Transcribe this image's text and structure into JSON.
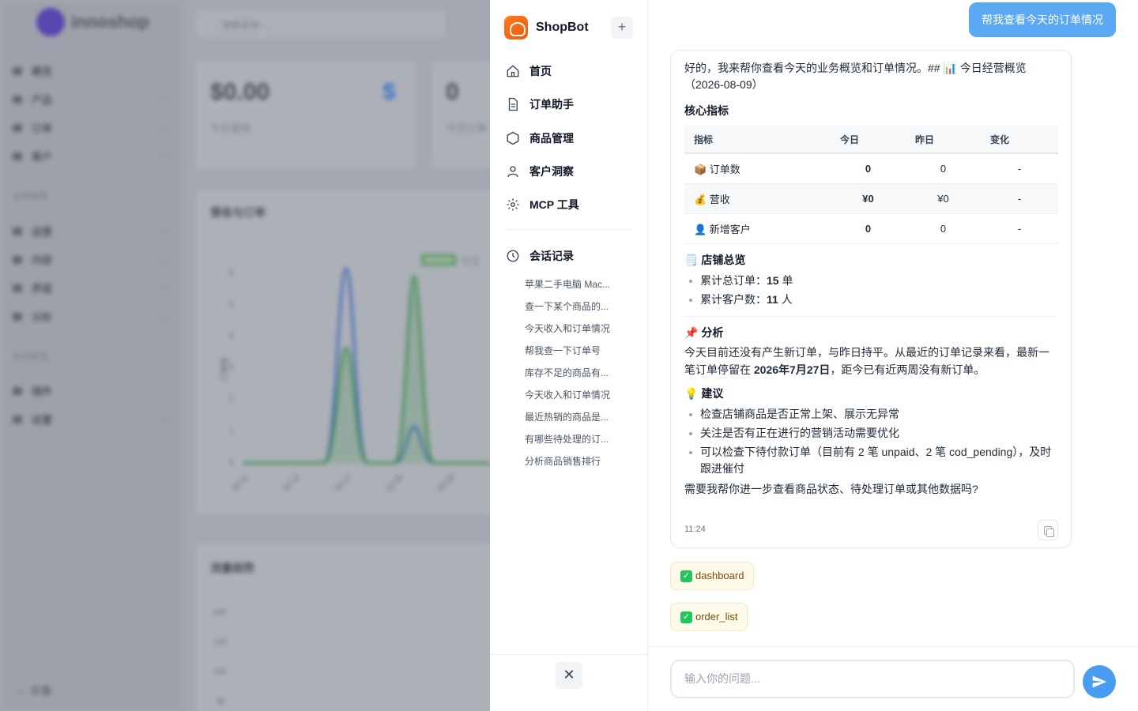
{
  "background_app": {
    "logo_text": "innoshop",
    "search_placeholder": "搜索菜单...",
    "nav": [
      "概览",
      "产品",
      "订单",
      "客户"
    ],
    "section1": "运营管理",
    "nav2": [
      "运营",
      "内容",
      "界面",
      "分析"
    ],
    "section2": "系统管理",
    "nav3": [
      "插件",
      "设置"
    ],
    "collapse": "折叠",
    "card1_value": "$0.00",
    "card1_label": "今日营收",
    "card1_icon": "$",
    "card2_value": "0",
    "card2_label": "今日订单",
    "chart_title": "营收与订单",
    "chart_legend": "今日",
    "chart_yticks": [
      "6",
      "5",
      "4",
      "3",
      "2",
      "1",
      "0"
    ],
    "chart_xticks": [
      "02-11",
      "02-14",
      "02-17",
      "02-20",
      "02-23"
    ],
    "chart_ylabel": "订单数",
    "chart2_title": "流量趋势",
    "chart2_yticks": [
      "140",
      "120",
      "100",
      "80"
    ]
  },
  "sidebar": {
    "brand": "ShopBot",
    "new_chat": "+",
    "nav": [
      {
        "label": "首页",
        "icon": "home-icon"
      },
      {
        "label": "订单助手",
        "icon": "document-icon"
      },
      {
        "label": "商品管理",
        "icon": "hexagon-icon"
      },
      {
        "label": "客户洞察",
        "icon": "user-icon"
      },
      {
        "label": "MCP 工具",
        "icon": "gear-icon"
      }
    ],
    "history_title": "会话记录",
    "history": [
      "苹果二手电脑 Mac...",
      "查一下某个商品的...",
      "今天收入和订单情况",
      "帮我查一下订单号",
      "库存不足的商品有...",
      "今天收入和订单情况",
      "最近热销的商品是...",
      "有哪些待处理的订...",
      "分析商品销售排行"
    ],
    "close": "✕"
  },
  "chat": {
    "user_message": "帮我查看今天的订单情况",
    "ai": {
      "intro": "好的，我来帮你查看今天的业务概览和订单情况。## 📊 今日经营概览（2026-08-09）",
      "metrics_title": "核心指标",
      "table_headers": [
        "指标",
        "今日",
        "昨日",
        "变化"
      ],
      "table_rows": [
        [
          "📦 订单数",
          "0",
          "0",
          "-"
        ],
        [
          "💰 营收",
          "¥0",
          "¥0",
          "-"
        ],
        [
          "👤 新增客户",
          "0",
          "0",
          "-"
        ]
      ],
      "store_title": "🗒️ 店铺总览",
      "store_items": [
        {
          "label": "累计总订单：",
          "value": "15",
          "unit": " 单"
        },
        {
          "label": "累计客户数：",
          "value": "11",
          "unit": " 人"
        }
      ],
      "analysis_title": "📌 分析",
      "analysis_pre": "今天目前还没有产生新订单，与昨日持平。从最近的订单记录来看，最新一笔订单停留在 ",
      "analysis_date": "2026年7月27日",
      "analysis_post": "，距今已有近两周没有新订单。",
      "suggest_title": "💡 建议",
      "suggestions": [
        "检查店铺商品是否正常上架、展示无异常",
        "关注是否有正在进行的营销活动需要优化",
        "可以检查下待付款订单（目前有 2 笔 unpaid、2 笔 cod_pending），及时跟进催付"
      ],
      "closing": "需要我帮你进一步查看商品状态、待处理订单或其他数据吗?",
      "time": "11:24"
    },
    "tools": [
      "dashboard",
      "order_list"
    ],
    "input_placeholder": "输入你的问题..."
  }
}
